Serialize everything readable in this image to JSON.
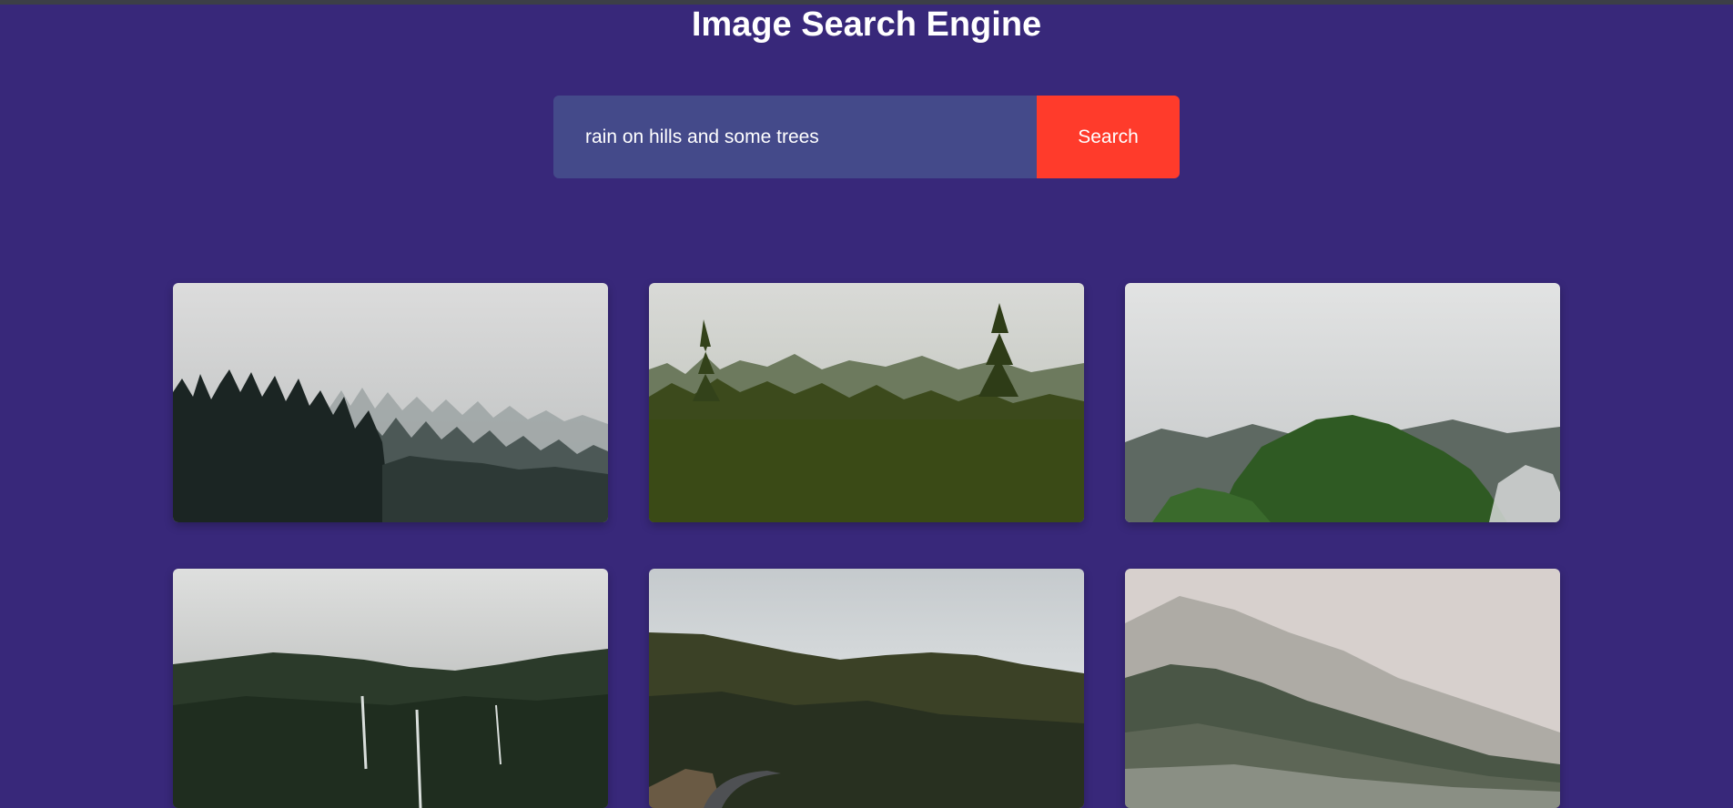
{
  "page": {
    "title": "Image Search Engine",
    "background_color": "#38287a"
  },
  "search": {
    "query": "rain on hills and some trees",
    "button_label": "Search",
    "input_color": "#444a8a",
    "button_color": "#ff3b2b"
  },
  "results": [
    {
      "subject": "dark conifer forest in fog"
    },
    {
      "subject": "green forest with tall pine in mist"
    },
    {
      "subject": "cloudy mountains with green trees"
    },
    {
      "subject": "misty mountain with waterfalls"
    },
    {
      "subject": "forested valley with winding road under clouds"
    },
    {
      "subject": "foggy pine-covered hillside"
    }
  ]
}
